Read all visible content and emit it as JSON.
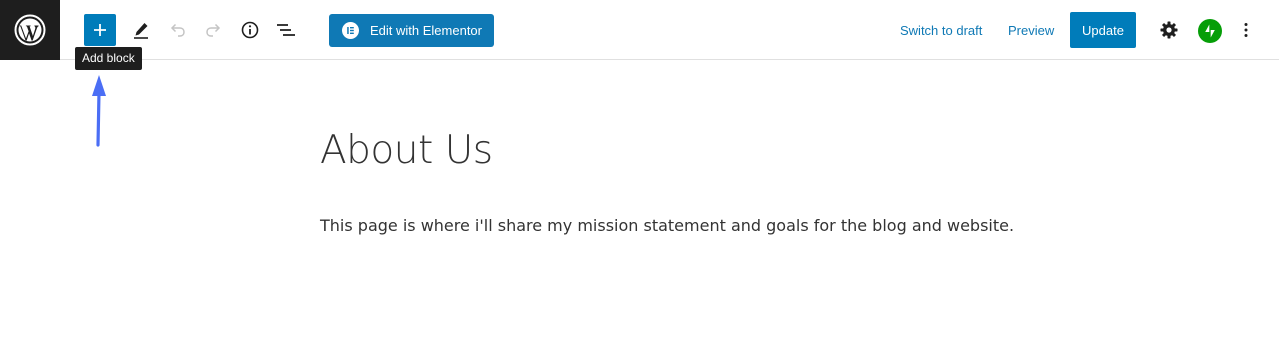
{
  "toolbar": {
    "add_block_tooltip": "Add block",
    "elementor_label": "Edit with Elementor",
    "switch_to_draft_label": "Switch to draft",
    "preview_label": "Preview",
    "update_label": "Update",
    "icons": {
      "logo": "wordpress-logo-icon",
      "add": "plus-icon",
      "tools": "pencil-icon",
      "undo": "undo-icon",
      "redo": "redo-icon",
      "details": "info-icon",
      "outline": "list-view-icon",
      "elementor": "elementor-icon",
      "settings": "gear-icon",
      "jetpack": "jetpack-icon",
      "more": "more-vertical-icon"
    }
  },
  "content": {
    "title": "About Us",
    "paragraph": "This page is where i'll share my mission statement and goals for the blog and website."
  },
  "colors": {
    "accent": "#007cba",
    "elementor": "#0f79b5",
    "annotation_arrow": "#4b6ef5",
    "jetpack": "#069e08"
  }
}
